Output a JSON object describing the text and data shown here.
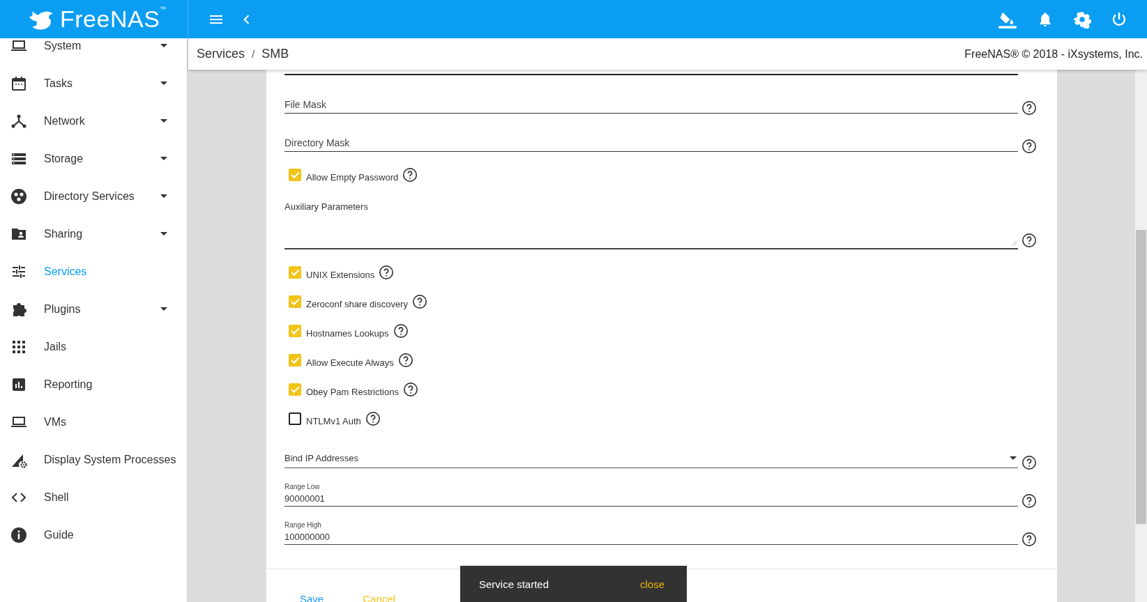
{
  "app": {
    "logo": "FreeNAS$^{™}$"
  },
  "sidebar": {
    "items": [
      {
        "label": "System",
        "expandable": true,
        "selected": false
      },
      {
        "label": "Tasks",
        "expandable": true,
        "selected": false
      },
      {
        "label": "Network",
        "expandable": true,
        "selected": false
      },
      {
        "label": "Storage",
        "expandable": true,
        "selected": false
      },
      {
        "label": "Directory Services",
        "expandable": true,
        "selected": false
      },
      {
        "label": "Sharing",
        "expandable": true,
        "selected": false
      },
      {
        "label": "Services",
        "expandable": false,
        "selected": true
      },
      {
        "label": "Plugins",
        "expandable": true,
        "selected": false
      },
      {
        "label": "Jails",
        "expandable": false,
        "selected": false
      },
      {
        "label": "Reporting",
        "expandable": false,
        "selected": false
      },
      {
        "label": "VMs",
        "expandable": false,
        "selected": false
      },
      {
        "label": "Display System Processes",
        "expandable": false,
        "selected": false
      },
      {
        "label": "Shell",
        "expandable": false,
        "selected": false
      },
      {
        "label": "Guide",
        "expandable": false,
        "selected": false
      }
    ]
  },
  "breadcrumb": {
    "items": [
      "Services",
      "SMB"
    ],
    "separator": "/"
  },
  "copyright": "FreeNAS® © 2018 - iXsystems, Inc.",
  "form": {
    "fields": [
      {
        "kind": "cut"
      },
      {
        "kind": "input",
        "placeholder": "File Mask"
      },
      {
        "kind": "input",
        "placeholder": "Directory Mask"
      },
      {
        "kind": "checkbox",
        "label": "Allow Empty Password",
        "checked": true
      },
      {
        "kind": "textarea",
        "label": "Auxiliary Parameters"
      },
      {
        "kind": "checkbox",
        "label": "UNIX Extensions",
        "checked": true
      },
      {
        "kind": "checkbox",
        "label": "Zeroconf share discovery",
        "checked": true
      },
      {
        "kind": "checkbox",
        "label": "Hostnames Lookups",
        "checked": true
      },
      {
        "kind": "checkbox",
        "label": "Allow Execute Always",
        "checked": true
      },
      {
        "kind": "checkbox",
        "label": "Obey Pam Restrictions",
        "checked": true
      },
      {
        "kind": "checkbox",
        "label": "NTLMv1 Auth",
        "checked": false
      },
      {
        "kind": "select",
        "placeholder": "Bind IP Addresses"
      },
      {
        "kind": "input",
        "label": "Range Low",
        "value": "90000001"
      },
      {
        "kind": "input",
        "label": "Range High",
        "value": "100000000"
      }
    ],
    "actions": [
      {
        "label": "Save",
        "kind": "primary"
      },
      {
        "label": "Cancel",
        "kind": "secondary"
      }
    ]
  },
  "toast": {
    "message": "Service started",
    "action": "close"
  }
}
